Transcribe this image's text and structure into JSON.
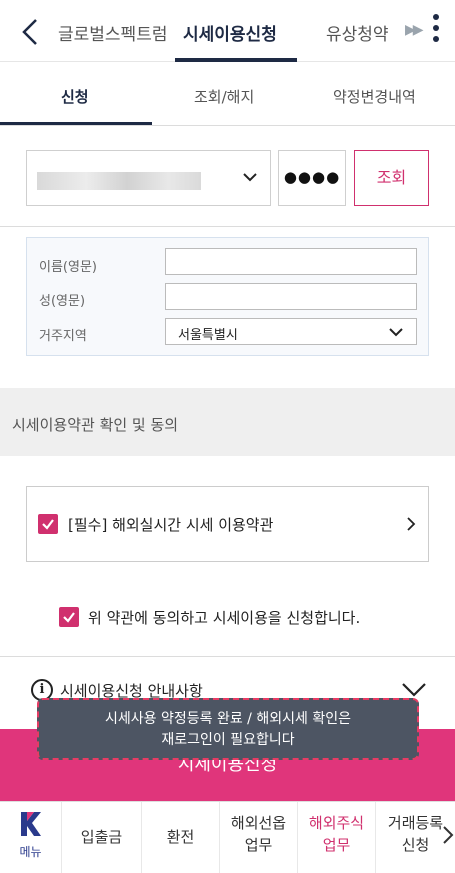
{
  "top_tabs": [
    "글로벌스펙트럼",
    "시세이용신청",
    "유상청약"
  ],
  "sub_tabs": [
    "신청",
    "조회/해지",
    "약정변경내역"
  ],
  "account": {
    "password_mask": "●●●●",
    "lookup_label": "조회"
  },
  "form": {
    "first_name_label": "이름(영문)",
    "last_name_label": "성(영문)",
    "region_label": "거주지역",
    "region_value": "서울특별시"
  },
  "terms": {
    "section_title": "시세이용약관 확인 및 동의",
    "required_item": "[필수] 해외실시간 시세 이용약관",
    "agree_text": "위 약관에 동의하고 시세이용을 신청합니다."
  },
  "guide": {
    "text": "시세이용신청 안내사항"
  },
  "submit_label": "시세이용신청",
  "toast": {
    "line1": "시세사용 약정등록 완료 / 해외시세 확인은",
    "line2": "재로그인이 필요합니다"
  },
  "bottom_nav": {
    "menu": "메뉴",
    "deposit": "입출금",
    "exchange": "환전",
    "futures_1": "해외선옵",
    "futures_2": "업무",
    "stocks_1": "해외주식",
    "stocks_2": "업무",
    "register_1": "거래등록",
    "register_2": "신청"
  },
  "colors": {
    "brand_pink": "#e0357b",
    "navy": "#1e2a44",
    "toast_bg": "#4d5563"
  }
}
